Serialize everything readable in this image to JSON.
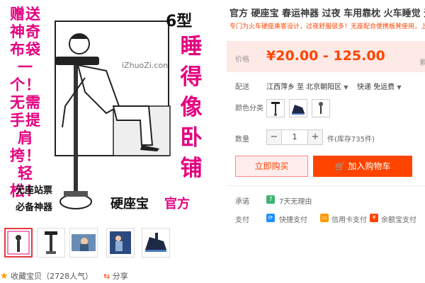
{
  "product": {
    "title": "官方 硬座宝 春运神器 过夜 车用靠枕 火车睡觉 无座",
    "subtitle": "专门为火车硬座乘客设计，过夜舒服很多！无座配合便携板凳使用，上",
    "price_label": "价格",
    "price": "¥20.00 - 125.00",
    "price_cut": "累"
  },
  "image_text": {
    "side_slogan": "赠送神奇布袋一个！无需手提肩挎！轻松！",
    "model": "6型",
    "big_slogan": "睡得像卧铺",
    "watermark": "iZhuoZi.con",
    "bottom_line1": "无座站票",
    "bottom_line2": "必备神器",
    "brand": "硬座宝",
    "brand_suffix": "官方"
  },
  "shipping": {
    "label": "配送",
    "from": "江西萍乡 至",
    "to": "北京朝阳区",
    "method": "快递 免运费"
  },
  "options": {
    "label": "颜色分类"
  },
  "quantity": {
    "label": "数量",
    "value": "1",
    "minus": "−",
    "plus": "+",
    "stock": "件(库存735件)"
  },
  "buttons": {
    "buy_now": "立即购买",
    "add_cart": "加入购物车"
  },
  "promise": {
    "label": "承诺",
    "badge": "7",
    "text": "7天无理由"
  },
  "payment": {
    "label": "支付",
    "items": [
      "快捷支付",
      "信用卡支付",
      "余额宝支付"
    ]
  },
  "footer": {
    "favorite": "收藏宝贝（2728人气）",
    "share": "分享"
  },
  "colors": {
    "accent": "#ff4400",
    "magenta": "#e4007f",
    "price_bg": "#fde9e6"
  }
}
